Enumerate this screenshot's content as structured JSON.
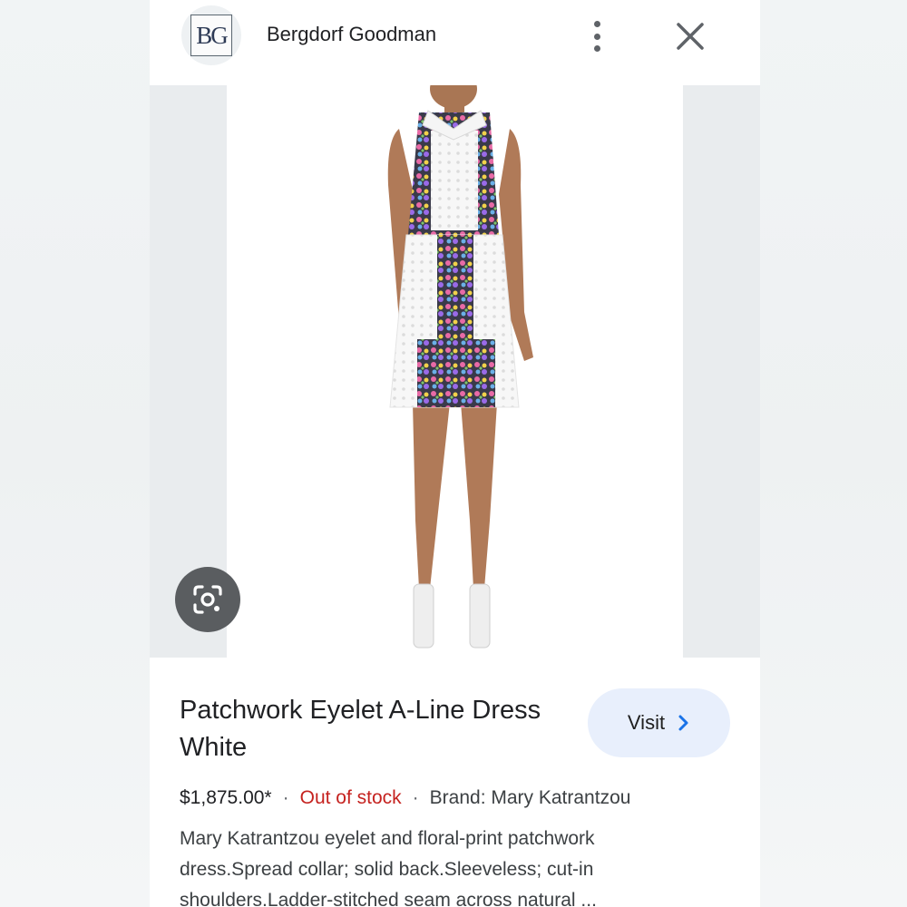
{
  "header": {
    "logo_text": "BG",
    "store_name": "Bergdorf Goodman",
    "more_icon": "more-vert-icon",
    "close_icon": "close-icon"
  },
  "image": {
    "alt": "Patchwork Eyelet A-Line Dress White",
    "lens_icon": "google-lens-icon"
  },
  "product": {
    "title": "Patchwork Eyelet A-Line Dress White",
    "visit_label": "Visit",
    "price": "$1,875.00*",
    "separator": "·",
    "stock": "Out of stock",
    "brand": "Brand: Mary Katrantzou",
    "description": "Mary Katrantzou eyelet and floral-print patchwork dress.Spread collar; solid back.Sleeveless; cut-in shoulders.Ladder-stitched seam across natural ..."
  },
  "colors": {
    "stock_red": "#c5221f",
    "visit_bg": "#e8effc",
    "link_blue": "#1a73e8"
  }
}
